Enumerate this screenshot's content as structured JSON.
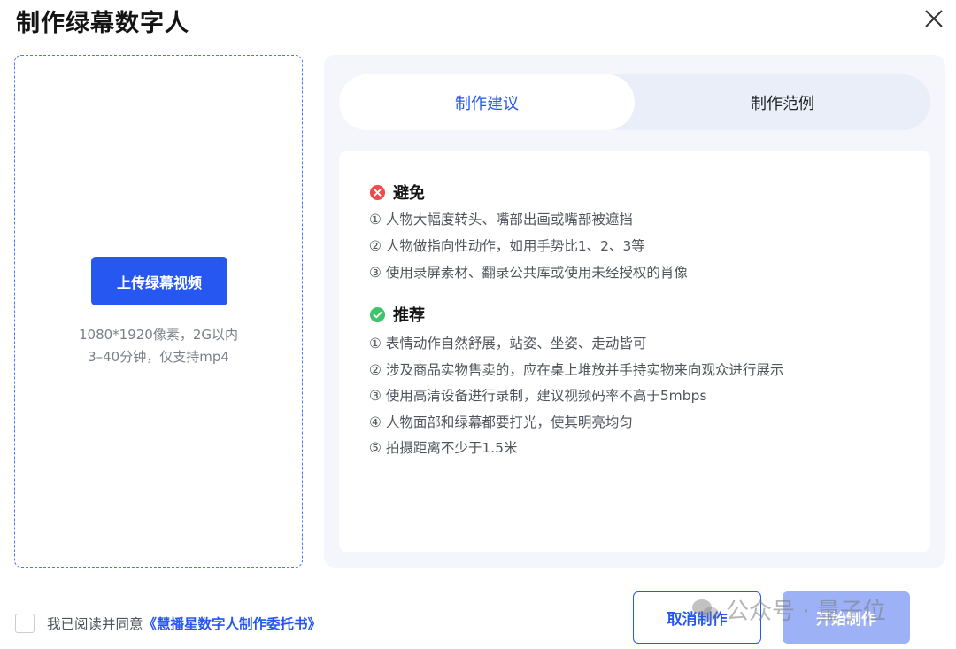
{
  "dialog": {
    "title": "制作绿幕数字人"
  },
  "upload": {
    "button_label": "上传绿幕视频",
    "hint_line1": "1080*1920像素，2G以内",
    "hint_line2": "3–40分钟，仅支持mp4"
  },
  "tabs": [
    {
      "label": "制作建议",
      "active": true
    },
    {
      "label": "制作范例",
      "active": false
    }
  ],
  "avoid": {
    "heading": "避免",
    "icon": "error-circle-icon",
    "icon_color": "#f04b4b",
    "items": [
      "① 人物大幅度转头、嘴部出画或嘴部被遮挡",
      "② 人物做指向性动作，如用手势比1、2、3等",
      "③ 使用录屏素材、翻录公共库或使用未经授权的肖像"
    ]
  },
  "recommend": {
    "heading": "推荐",
    "icon": "check-circle-icon",
    "icon_color": "#3ec46d",
    "items": [
      "① 表情动作自然舒展，站姿、坐姿、走动皆可",
      "② 涉及商品实物售卖的，应在桌上堆放并手持实物来向观众进行展示",
      "③ 使用高清设备进行录制，建议视频码率不高于5mbps",
      "④ 人物面部和绿幕都要打光，使其明亮均匀",
      "⑤ 拍摄距离不少于1.5米"
    ]
  },
  "footer": {
    "agree_text": "我已阅读并同意",
    "agree_link": "《慧播星数字人制作委托书》",
    "cancel_label": "取消制作",
    "start_label": "开始制作"
  },
  "watermark": {
    "text": "公众号 · 量子位"
  },
  "colors": {
    "accent": "#2657f0",
    "disabled_accent": "#9db2f6"
  }
}
